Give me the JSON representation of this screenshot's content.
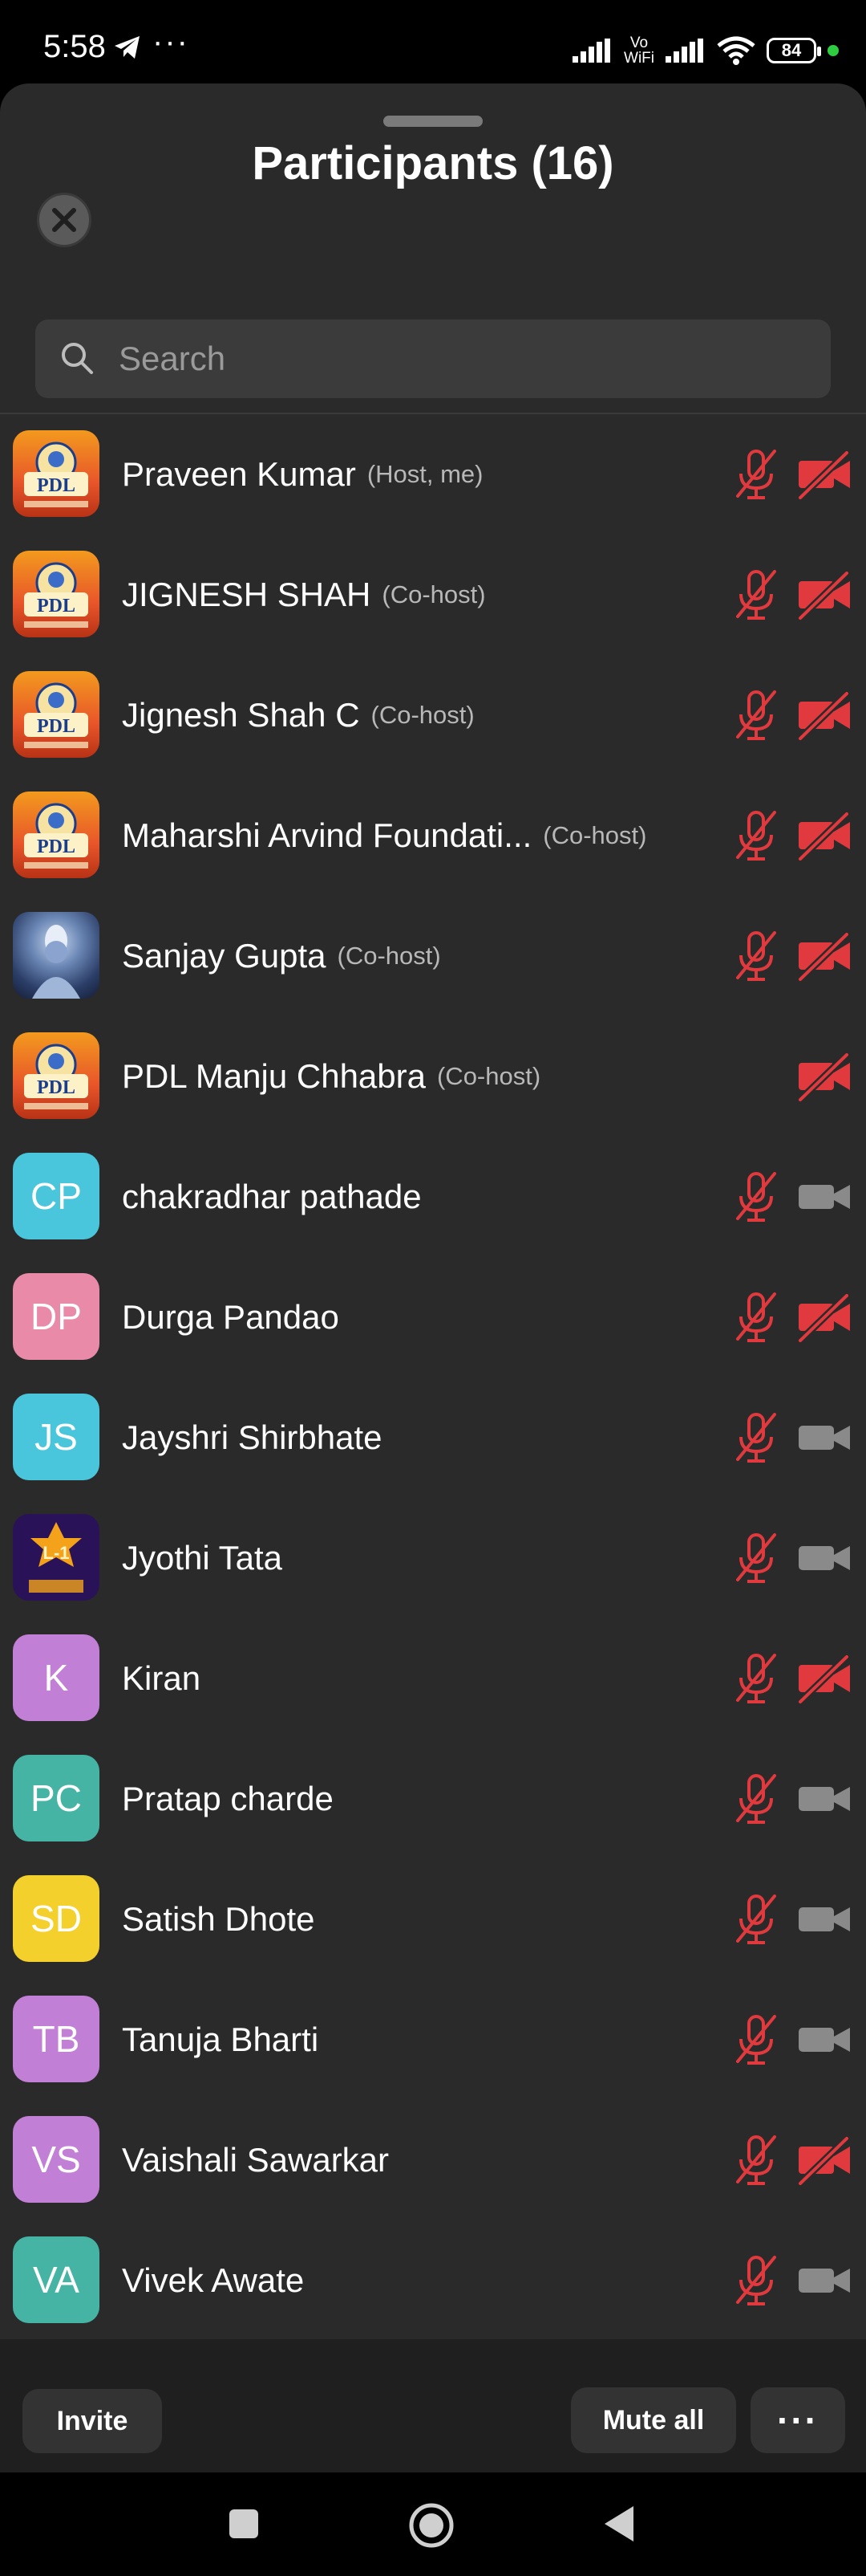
{
  "status_bar": {
    "time": "5:58",
    "dots": "···",
    "vowifi_line1": "Vo",
    "vowifi_line2": "WiFi",
    "battery": "84"
  },
  "header": {
    "title": "Participants (16)"
  },
  "search": {
    "placeholder": "Search"
  },
  "participants": [
    {
      "name": "Praveen Kumar",
      "role": "(Host, me)",
      "avatar": "pdl",
      "mic": "muted",
      "video": "off"
    },
    {
      "name": "JIGNESH SHAH",
      "role": "(Co-host)",
      "avatar": "pdl",
      "mic": "muted",
      "video": "off"
    },
    {
      "name": "Jignesh Shah C",
      "role": "(Co-host)",
      "avatar": "pdl",
      "mic": "muted",
      "video": "off"
    },
    {
      "name": "Maharshi Arvind Foundati...",
      "role": "(Co-host)",
      "avatar": "pdl",
      "mic": "muted",
      "video": "off"
    },
    {
      "name": "Sanjay Gupta",
      "role": "(Co-host)",
      "avatar": "shiva",
      "mic": "muted",
      "video": "off"
    },
    {
      "name": "PDL Manju Chhabra",
      "role": "(Co-host)",
      "avatar": "pdl",
      "mic": "none",
      "video": "off"
    },
    {
      "name": "chakradhar pathade",
      "role": "",
      "initials": "CP",
      "color": "#49c6dc",
      "mic": "muted",
      "video": "on"
    },
    {
      "name": "Durga Pandao",
      "role": "",
      "initials": "DP",
      "color": "#e88aa8",
      "mic": "muted",
      "video": "off"
    },
    {
      "name": "Jayshri Shirbhate",
      "role": "",
      "initials": "JS",
      "color": "#49c6dc",
      "mic": "muted",
      "video": "on"
    },
    {
      "name": "Jyothi Tata",
      "role": "",
      "avatar": "l1",
      "mic": "muted",
      "video": "on"
    },
    {
      "name": "Kiran",
      "role": "",
      "initials": "K",
      "color": "#c17fd6",
      "mic": "muted",
      "video": "off"
    },
    {
      "name": "Pratap charde",
      "role": "",
      "initials": "PC",
      "color": "#46b4a4",
      "mic": "muted",
      "video": "on"
    },
    {
      "name": "Satish Dhote",
      "role": "",
      "initials": "SD",
      "color": "#f4d02c",
      "mic": "muted",
      "video": "on"
    },
    {
      "name": "Tanuja Bharti",
      "role": "",
      "initials": "TB",
      "color": "#c17fd6",
      "mic": "muted",
      "video": "on"
    },
    {
      "name": "Vaishali Sawarkar",
      "role": "",
      "initials": "VS",
      "color": "#c17fd6",
      "mic": "muted",
      "video": "off"
    },
    {
      "name": "Vivek Awate",
      "role": "",
      "initials": "VA",
      "color": "#46b4a4",
      "mic": "muted",
      "video": "on"
    }
  ],
  "avatar_text": {
    "pdl": "PDL",
    "l1": "L-1"
  },
  "footer": {
    "invite_label": "Invite",
    "mute_all_label": "Mute all",
    "more_label": "···"
  },
  "colors": {
    "sheet_bg": "#2a2a2a",
    "muted_red": "#e0393e",
    "cam_on_grey": "#8a8a8a"
  }
}
